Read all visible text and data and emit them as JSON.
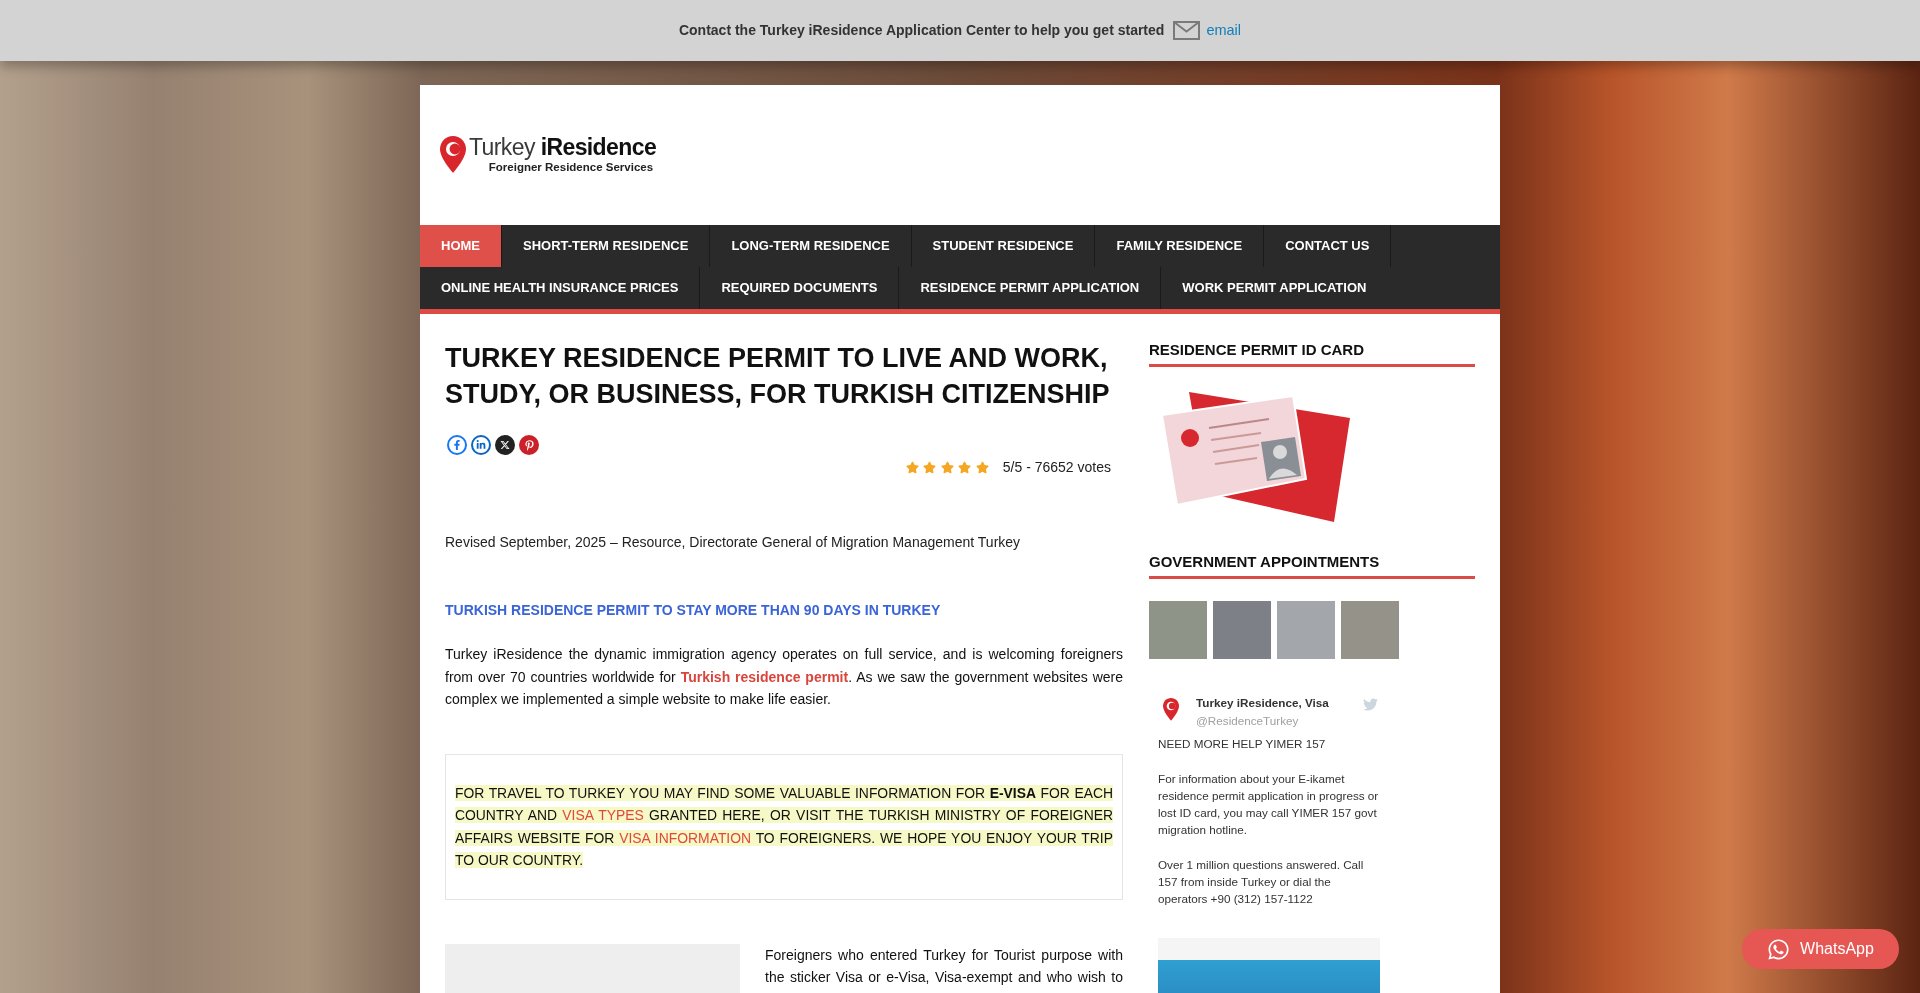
{
  "top_bar": {
    "message": "Contact the Turkey iResidence Application Center to help you get started",
    "link": "email"
  },
  "logo": {
    "title": "Turkey **iResidence**",
    "tagline": "Foreigner Residence Services"
  },
  "nav": {
    "items": [
      {
        "label": "HOME",
        "selected": true
      },
      {
        "label": "SHORT-TERM RESIDENCE",
        "selected": false
      },
      {
        "label": "LONG-TERM RESIDENCE",
        "selected": false
      },
      {
        "label": "STUDENT RESIDENCE",
        "selected": false
      },
      {
        "label": "FAMILY RESIDENCE",
        "selected": false
      },
      {
        "label": "CONTACT US",
        "selected": false
      },
      {
        "label": "ONLINE HEALTH INSURANCE PRICES",
        "selected": false
      },
      {
        "label": "REQUIRED DOCUMENTS",
        "selected": false
      },
      {
        "label": "RESIDENCE PERMIT APPLICATION",
        "selected": false
      },
      {
        "label": "WORK PERMIT APPLICATION",
        "selected": false
      }
    ]
  },
  "article": {
    "title": "TURKEY RESIDENCE PERMIT TO LIVE AND WORK, STUDY, OR BUSINESS, FOR TURKISH CITIZENSHIP",
    "rating": {
      "stars": 5,
      "reading": "5/5 - 76652 votes"
    },
    "revised": "Revised September, 2025 – Resource, Directorate General of Migration Management Turkey",
    "subheading": "TURKISH RESIDENCE PERMIT TO STAY MORE THAN 90 DAYS IN TURKEY",
    "intro": [
      {
        "kind": "text",
        "text": "Turkey iResidence the dynamic immigration agency operates on full service, and is welcoming foreigners from over 70 countries worldwide for "
      },
      {
        "kind": "bold_link",
        "text": "Turkish residence permit"
      },
      {
        "kind": "text",
        "text": ". As we saw the government websites were complex we implemented a simple website to make life easier."
      }
    ],
    "notice": [
      {
        "kind": "text",
        "text": "FOR TRAVEL TO TURKEY YOU MAY FIND SOME VALUABLE INFORMATION FOR "
      },
      {
        "kind": "bold",
        "text": "E-VISA"
      },
      {
        "kind": "text",
        "text": " FOR EACH COUNTRY AND "
      },
      {
        "kind": "link",
        "text": "VISA TYPES"
      },
      {
        "kind": "text",
        "text": " GRANTED HERE, OR VISIT THE TURKISH MINISTRY OF FOREIGNER AFFAIRS WEBSITE FOR "
      },
      {
        "kind": "link",
        "text": "VISA INFORMATION"
      },
      {
        "kind": "text",
        "text": " TO FOREIGNERS. WE HOPE YOU ENJOY YOUR TRIP TO OUR COUNTRY."
      }
    ],
    "lower_text": "Foreigners who entered Turkey for Tourist purpose with the sticker Visa or e-Visa, Visa-exempt and who wish to"
  },
  "sidebar": {
    "widgets": [
      {
        "kind": "image",
        "title": "RESIDENCE PERMIT ID CARD"
      },
      {
        "kind": "gallery",
        "title": "GOVERNMENT APPOINTMENTS"
      }
    ],
    "tweet": {
      "name": "Turkey iResidence, Visa",
      "handle": "@ResidenceTurkey",
      "paragraphs": [
        "NEED MORE HELP YIMER 157",
        "For information about your E-ikamet residence permit application in progress or lost ID card, you may call YIMER 157 govt migration hotline.",
        "Over 1 million questions answered. Call 157 from inside Turkey or dial the operators +90 (312) 157-1122"
      ]
    }
  },
  "whatsapp": {
    "label": "WhatsApp"
  }
}
